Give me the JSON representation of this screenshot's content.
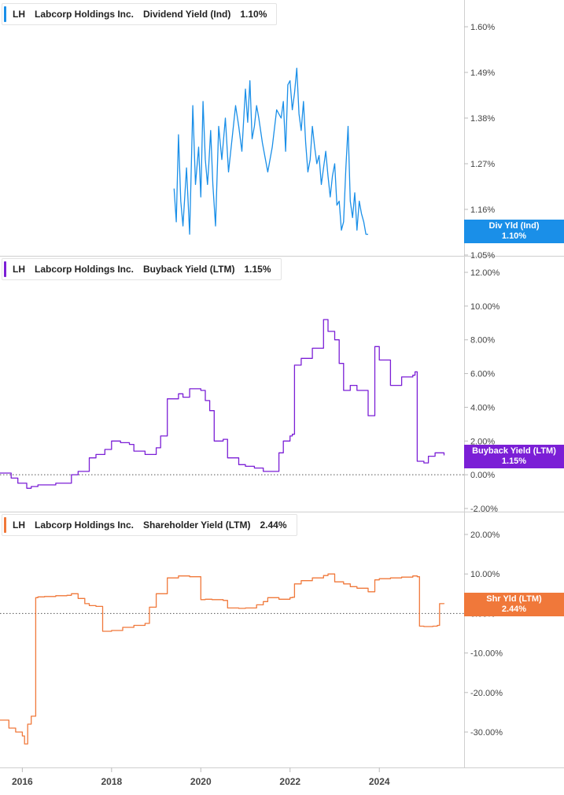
{
  "chart_data": [
    {
      "type": "line",
      "ticker": "LH",
      "company": "Labcorp Holdings Inc.",
      "metric": "Dividend Yield (Ind)",
      "current_value": "1.10%",
      "tag_label": "Div Yld (Ind)",
      "tag_value": "1.10%",
      "color": "#1a8fe8",
      "ylim": [
        1.05,
        1.66
      ],
      "yticks": [
        1.05,
        1.16,
        1.27,
        1.38,
        1.49,
        1.6
      ],
      "ytick_labels": [
        "1.05%",
        "1.16%",
        "1.27%",
        "1.38%",
        "1.49%",
        "1.60%"
      ],
      "zero_line": false,
      "x": [
        2019.4,
        2019.45,
        2019.5,
        2019.55,
        2019.6,
        2019.68,
        2019.75,
        2019.82,
        2019.88,
        2019.95,
        2020.0,
        2020.05,
        2020.1,
        2020.15,
        2020.18,
        2020.22,
        2020.27,
        2020.33,
        2020.4,
        2020.47,
        2020.55,
        2020.62,
        2020.7,
        2020.78,
        2020.85,
        2020.92,
        2021.0,
        2021.05,
        2021.1,
        2021.15,
        2021.2,
        2021.25,
        2021.3,
        2021.38,
        2021.45,
        2021.5,
        2021.6,
        2021.7,
        2021.8,
        2021.85,
        2021.9,
        2021.95,
        2022.0,
        2022.05,
        2022.1,
        2022.15,
        2022.2,
        2022.25,
        2022.3,
        2022.35,
        2022.4,
        2022.45,
        2022.5,
        2022.55,
        2022.6,
        2022.65,
        2022.7,
        2022.75,
        2022.8,
        2022.85,
        2022.9,
        2022.95,
        2023.0,
        2023.05,
        2023.1,
        2023.15,
        2023.2,
        2023.25,
        2023.3,
        2023.35,
        2023.4,
        2023.45,
        2023.5,
        2023.55,
        2023.6,
        2023.65,
        2023.7,
        2023.75
      ],
      "values": [
        1.21,
        1.13,
        1.34,
        1.18,
        1.12,
        1.26,
        1.1,
        1.41,
        1.22,
        1.31,
        1.19,
        1.42,
        1.28,
        1.22,
        1.27,
        1.35,
        1.22,
        1.12,
        1.36,
        1.28,
        1.38,
        1.25,
        1.33,
        1.41,
        1.36,
        1.3,
        1.45,
        1.37,
        1.47,
        1.33,
        1.36,
        1.41,
        1.38,
        1.32,
        1.28,
        1.25,
        1.31,
        1.4,
        1.38,
        1.42,
        1.3,
        1.46,
        1.47,
        1.4,
        1.44,
        1.5,
        1.39,
        1.35,
        1.42,
        1.32,
        1.25,
        1.28,
        1.36,
        1.31,
        1.27,
        1.29,
        1.22,
        1.26,
        1.3,
        1.24,
        1.19,
        1.24,
        1.27,
        1.17,
        1.18,
        1.11,
        1.13,
        1.26,
        1.36,
        1.18,
        1.14,
        1.2,
        1.11,
        1.18,
        1.15,
        1.13,
        1.1,
        1.1
      ]
    },
    {
      "type": "line",
      "ticker": "LH",
      "company": "Labcorp Holdings Inc.",
      "metric": "Buyback Yield (LTM)",
      "current_value": "1.15%",
      "tag_label": "Buyback Yield (LTM)",
      "tag_value": "1.15%",
      "color": "#7b1fd6",
      "ylim": [
        -2.0,
        12.0
      ],
      "yticks": [
        -2,
        0,
        2,
        4,
        6,
        8,
        10,
        12
      ],
      "ytick_labels": [
        "-2.00%",
        "0.00%",
        "2.00%",
        "4.00%",
        "6.00%",
        "8.00%",
        "10.00%",
        "12.00%"
      ],
      "zero_line": true,
      "x": [
        2015.5,
        2015.75,
        2015.9,
        2016.1,
        2016.2,
        2016.35,
        2016.5,
        2016.75,
        2017.0,
        2017.1,
        2017.25,
        2017.4,
        2017.5,
        2017.65,
        2017.85,
        2018.0,
        2018.2,
        2018.4,
        2018.5,
        2018.75,
        2019.0,
        2019.1,
        2019.25,
        2019.5,
        2019.6,
        2019.75,
        2020.0,
        2020.1,
        2020.2,
        2020.3,
        2020.5,
        2020.6,
        2020.85,
        2021.0,
        2021.2,
        2021.4,
        2021.55,
        2021.75,
        2021.85,
        2022.0,
        2022.05,
        2022.1,
        2022.25,
        2022.5,
        2022.75,
        2022.85,
        2023.0,
        2023.1,
        2023.2,
        2023.35,
        2023.5,
        2023.75,
        2023.9,
        2024.0,
        2024.25,
        2024.5,
        2024.75,
        2024.8,
        2024.85,
        2025.0,
        2025.1,
        2025.25,
        2025.45
      ],
      "values": [
        0.1,
        -0.2,
        -0.5,
        -0.8,
        -0.7,
        -0.6,
        -0.6,
        -0.5,
        -0.5,
        0.0,
        0.2,
        0.2,
        1.0,
        1.2,
        1.5,
        2.0,
        1.9,
        1.8,
        1.4,
        1.2,
        1.6,
        2.3,
        4.5,
        4.8,
        4.6,
        5.1,
        5.0,
        4.4,
        3.8,
        2.0,
        2.1,
        1.0,
        0.6,
        0.5,
        0.4,
        0.2,
        0.2,
        1.3,
        2.0,
        2.3,
        2.4,
        6.5,
        6.9,
        7.5,
        9.2,
        8.5,
        8.0,
        6.6,
        5.0,
        5.3,
        5.0,
        3.5,
        7.6,
        6.8,
        5.3,
        5.8,
        5.9,
        6.1,
        0.8,
        0.7,
        1.1,
        1.3,
        1.15
      ]
    },
    {
      "type": "line",
      "ticker": "LH",
      "company": "Labcorp Holdings Inc.",
      "metric": "Shareholder Yield (LTM)",
      "current_value": "2.44%",
      "tag_label": "Shr Yld (LTM)",
      "tag_value": "2.44%",
      "color": "#f0783a",
      "ylim": [
        -38,
        26
      ],
      "yticks": [
        -30,
        -20,
        -10,
        0,
        10,
        20
      ],
      "ytick_labels": [
        "-30.00%",
        "-20.00%",
        "-10.00%",
        "0.00%",
        "10.00%",
        "20.00%"
      ],
      "zero_line": true,
      "x": [
        2015.5,
        2015.7,
        2015.85,
        2016.0,
        2016.05,
        2016.12,
        2016.2,
        2016.3,
        2016.35,
        2016.5,
        2016.75,
        2017.0,
        2017.1,
        2017.25,
        2017.4,
        2017.5,
        2017.65,
        2017.8,
        2018.0,
        2018.25,
        2018.5,
        2018.75,
        2018.85,
        2019.0,
        2019.25,
        2019.5,
        2019.75,
        2020.0,
        2020.1,
        2020.25,
        2020.5,
        2020.6,
        2020.85,
        2021.0,
        2021.25,
        2021.4,
        2021.5,
        2021.75,
        2022.0,
        2022.05,
        2022.1,
        2022.25,
        2022.5,
        2022.75,
        2022.85,
        2023.0,
        2023.2,
        2023.35,
        2023.5,
        2023.75,
        2023.9,
        2024.0,
        2024.25,
        2024.5,
        2024.75,
        2024.85,
        2024.9,
        2025.0,
        2025.2,
        2025.3,
        2025.35,
        2025.45
      ],
      "values": [
        -27,
        -29,
        -30,
        -31,
        -33,
        -28,
        -26,
        4.0,
        4.2,
        4.3,
        4.5,
        4.6,
        5.0,
        3.8,
        2.5,
        2.0,
        1.8,
        -4.5,
        -4.3,
        -3.5,
        -3.0,
        -2.5,
        1.6,
        5.0,
        9.0,
        9.5,
        9.3,
        3.5,
        3.6,
        3.5,
        3.3,
        1.4,
        1.3,
        1.4,
        2.2,
        3.0,
        4.0,
        3.6,
        4.0,
        4.1,
        7.5,
        8.3,
        9.0,
        9.6,
        10.0,
        8.0,
        7.5,
        6.8,
        6.4,
        5.5,
        8.5,
        8.8,
        9.0,
        9.2,
        9.5,
        9.3,
        -3.2,
        -3.3,
        -3.2,
        -3.0,
        2.5,
        2.44
      ]
    }
  ],
  "xaxis": {
    "range": [
      2015.5,
      2025.9
    ],
    "ticks": [
      2016,
      2018,
      2020,
      2022,
      2024
    ],
    "tick_labels": [
      "2016",
      "2018",
      "2020",
      "2022",
      "2024"
    ]
  },
  "grid": false
}
